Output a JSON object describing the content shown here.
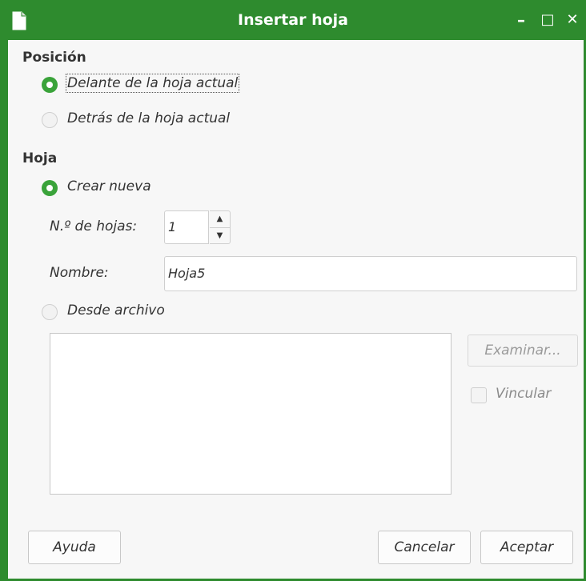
{
  "window": {
    "title": "Insertar hoja",
    "controls": {
      "minimize": "–",
      "maximize": "□",
      "close": "✕"
    },
    "accent_color": "#2e8b2e"
  },
  "position": {
    "heading": "Posición",
    "before_label": "Delante de la hoja actual",
    "after_label": "Detrás de la hoja actual",
    "selected": "before"
  },
  "sheet": {
    "heading": "Hoja",
    "new_label": "Crear nueva",
    "count_label": "N.º de hojas:",
    "count_value": "1",
    "name_label": "Nombre:",
    "name_value": "Hoja5",
    "from_file_label": "Desde archivo",
    "browse_label": "Examinar...",
    "link_label": "Vincular",
    "selected": "new"
  },
  "footer": {
    "help_label": "Ayuda",
    "cancel_label": "Cancelar",
    "ok_label": "Aceptar"
  }
}
